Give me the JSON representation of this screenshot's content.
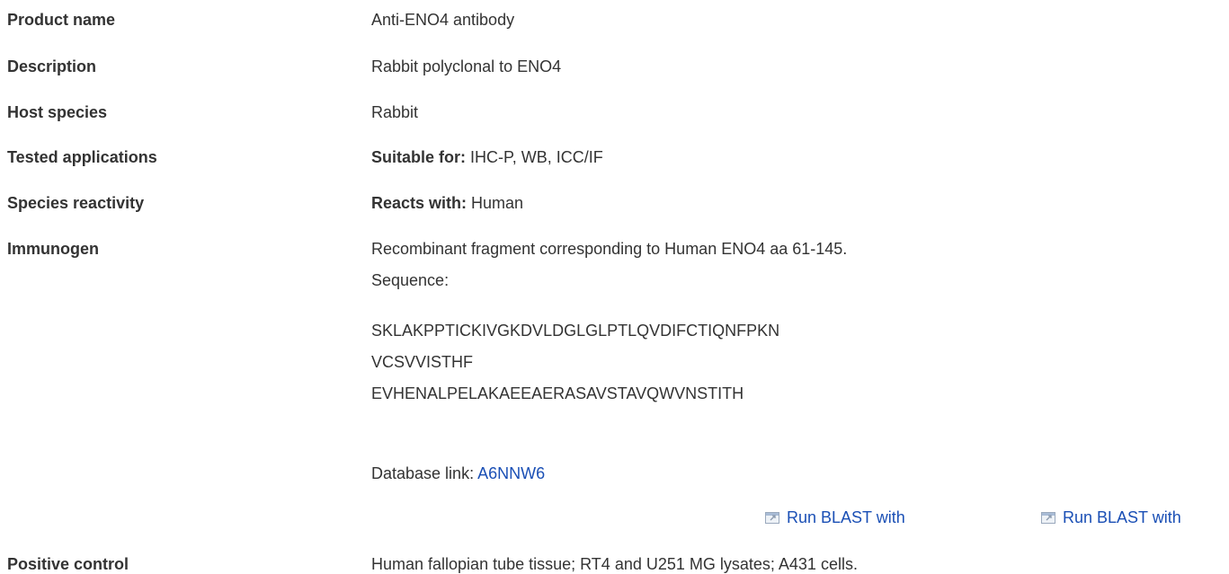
{
  "rows": {
    "product_name": {
      "label": "Product name",
      "value": "Anti-ENO4 antibody"
    },
    "description": {
      "label": "Description",
      "value": "Rabbit polyclonal to ENO4"
    },
    "host_species": {
      "label": "Host species",
      "value": "Rabbit"
    },
    "tested_applications": {
      "label": "Tested applications",
      "prefix": "Suitable for:",
      "value": "IHC-P, WB, ICC/IF"
    },
    "species_reactivity": {
      "label": "Species reactivity",
      "prefix": "Reacts with:",
      "value": "Human"
    },
    "immunogen": {
      "label": "Immunogen",
      "text": "Recombinant fragment corresponding to Human ENO4 aa 61-145.",
      "sequence_label": "Sequence:",
      "sequence_lines": [
        "SKLAKPPTICKIVGKDVLDGLGLPTLQVDIFCTIQNFPKN",
        "VCSVVISTHF",
        "EVHENALPELAKAEEAERASAVSTAVQWVNSTITH"
      ],
      "database_label": "Database link:",
      "database_id": "A6NNW6",
      "blast_links": [
        "Run BLAST with",
        "Run BLAST with"
      ]
    },
    "positive_control": {
      "label": "Positive control",
      "value": "Human fallopian tube tissue; RT4 and U251 MG lysates; A431 cells."
    }
  },
  "icons": {
    "external_link": "external-link-icon"
  },
  "colors": {
    "link": "#1a4fb5",
    "text": "#333333"
  }
}
